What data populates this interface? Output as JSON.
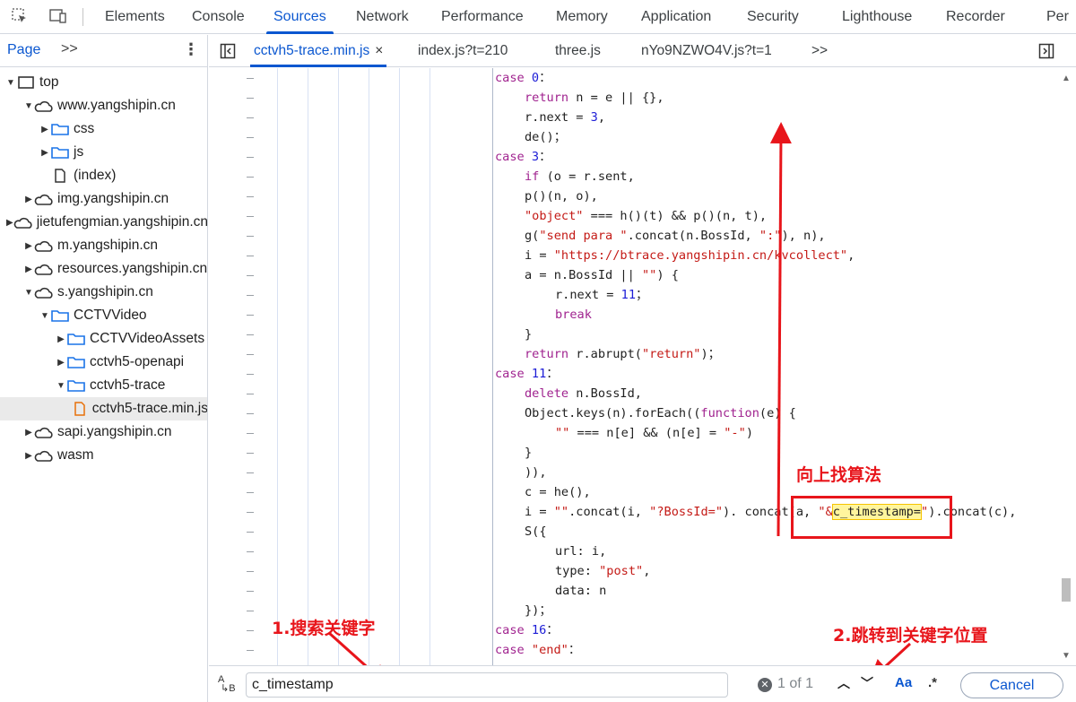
{
  "top_tabs": [
    "Elements",
    "Console",
    "Sources",
    "Network",
    "Performance",
    "Memory",
    "Application",
    "Security",
    "Lighthouse",
    "Recorder",
    "Per"
  ],
  "active_top_tab": "Sources",
  "navigator": {
    "tab": "Page",
    "more": ">>",
    "tree": [
      {
        "label": "top",
        "icon": "frame-icon",
        "arrow": "down"
      },
      {
        "label": "www.yangshipin.cn",
        "icon": "cloud-icon",
        "arrow": "down"
      },
      {
        "label": "css",
        "icon": "folder-icon",
        "arrow": "right"
      },
      {
        "label": "js",
        "icon": "folder-icon",
        "arrow": "right"
      },
      {
        "label": "(index)",
        "icon": "file-icon",
        "arrow": ""
      },
      {
        "label": "img.yangshipin.cn",
        "icon": "cloud-icon",
        "arrow": "right"
      },
      {
        "label": "jietufengmian.yangshipin.cn",
        "icon": "cloud-icon",
        "arrow": "right"
      },
      {
        "label": "m.yangshipin.cn",
        "icon": "cloud-icon",
        "arrow": "right"
      },
      {
        "label": "resources.yangshipin.cn",
        "icon": "cloud-icon",
        "arrow": "right"
      },
      {
        "label": "s.yangshipin.cn",
        "icon": "cloud-icon",
        "arrow": "down"
      },
      {
        "label": "CCTVVideo",
        "icon": "folder-icon",
        "arrow": "down"
      },
      {
        "label": "CCTVVideoAssets",
        "icon": "folder-icon",
        "arrow": "right"
      },
      {
        "label": "cctvh5-openapi",
        "icon": "folder-icon",
        "arrow": "right"
      },
      {
        "label": "cctvh5-trace",
        "icon": "folder-icon",
        "arrow": "down"
      },
      {
        "label": "cctvh5-trace.min.js",
        "icon": "js-file-icon",
        "arrow": "",
        "selected": true
      },
      {
        "label": "sapi.yangshipin.cn",
        "icon": "cloud-icon",
        "arrow": "right"
      },
      {
        "label": "wasm",
        "icon": "cloud-icon",
        "arrow": "right"
      }
    ]
  },
  "editor_tabs": [
    {
      "label": "cctvh5-trace.min.js",
      "active": true,
      "close": "×"
    },
    {
      "label": "index.js?t=210"
    },
    {
      "label": "three.js"
    },
    {
      "label": "nYo9NZWO4V.js?t=1"
    }
  ],
  "editor_tabs_more": ">>",
  "code_lines": [
    {
      "t": [
        [
          "kw",
          "case "
        ],
        [
          "num",
          "0"
        ],
        [
          "",
          "："
        ]
      ]
    },
    {
      "t": [
        [
          "kw",
          "return "
        ],
        [
          "",
          "n = e || {},"
        ]
      ]
    },
    {
      "t": [
        [
          "",
          "r.next = "
        ],
        [
          "num",
          "3"
        ],
        [
          "",
          ","
        ]
      ]
    },
    {
      "t": [
        [
          "",
          "de()；"
        ]
      ]
    },
    {
      "t": [
        [
          "kw",
          "case "
        ],
        [
          "num",
          "3"
        ],
        [
          "",
          "："
        ]
      ]
    },
    {
      "t": [
        [
          "kw",
          "if "
        ],
        [
          "",
          "(o = r.sent,"
        ]
      ]
    },
    {
      "t": [
        [
          "",
          "p()(n, o),"
        ]
      ]
    },
    {
      "t": [
        [
          "str",
          "\"object\""
        ],
        [
          "",
          " === h()(t) && p()(n, t),"
        ]
      ]
    },
    {
      "t": [
        [
          "",
          "g("
        ],
        [
          "str",
          "\"send para \""
        ],
        [
          "",
          ".concat(n.BossId, "
        ],
        [
          "str",
          "\":\""
        ],
        [
          "",
          "), n),"
        ]
      ]
    },
    {
      "t": [
        [
          "",
          "i = "
        ],
        [
          "str",
          "\"https://btrace.yangshipin.cn/kvcollect\""
        ],
        [
          "",
          ","
        ]
      ]
    },
    {
      "t": [
        [
          "",
          "a = n.BossId || "
        ],
        [
          "str",
          "\"\""
        ],
        [
          "",
          ") {"
        ]
      ]
    },
    {
      "t": [
        [
          "",
          "r.next = "
        ],
        [
          "num",
          "11"
        ],
        [
          "",
          "；"
        ]
      ]
    },
    {
      "t": [
        [
          "kw",
          "break"
        ]
      ]
    },
    {
      "t": [
        [
          "",
          "}"
        ]
      ]
    },
    {
      "t": [
        [
          "kw",
          "return "
        ],
        [
          "",
          "r.abrupt("
        ],
        [
          "str",
          "\"return\""
        ],
        [
          "",
          ")；"
        ]
      ]
    },
    {
      "t": [
        [
          "kw",
          "case "
        ],
        [
          "num",
          "11"
        ],
        [
          "",
          "："
        ]
      ]
    },
    {
      "t": [
        [
          "kw",
          "delete "
        ],
        [
          "",
          "n.BossId,"
        ]
      ]
    },
    {
      "t": [
        [
          "",
          "Object.keys(n).forEach(("
        ],
        [
          "kw",
          "function"
        ],
        [
          "",
          "(e) {"
        ]
      ]
    },
    {
      "t": [
        [
          "str",
          "\"\""
        ],
        [
          "",
          " === n[e] && (n[e] = "
        ],
        [
          "str",
          "\"-\""
        ],
        [
          "",
          ")"
        ]
      ]
    },
    {
      "t": [
        [
          "",
          "}"
        ]
      ]
    },
    {
      "t": [
        [
          "",
          ")),"
        ]
      ]
    },
    {
      "t": [
        [
          "",
          "c = he(),"
        ]
      ]
    },
    {
      "t": [
        [
          "",
          "i = "
        ],
        [
          "str",
          "\"\""
        ],
        [
          "",
          ".concat(i, "
        ],
        [
          "str",
          "\"?BossId=\""
        ],
        [
          "",
          "). concat(a, "
        ],
        [
          "str",
          "\"&"
        ],
        [
          "hl",
          "c_timestamp="
        ],
        [
          "str",
          "\""
        ],
        [
          "",
          ").concat(c),"
        ]
      ]
    },
    {
      "t": [
        [
          "",
          "S({"
        ]
      ]
    },
    {
      "t": [
        [
          "",
          "url: i,"
        ]
      ]
    },
    {
      "t": [
        [
          "",
          "type: "
        ],
        [
          "str",
          "\"post\""
        ],
        [
          "",
          ","
        ]
      ]
    },
    {
      "t": [
        [
          "",
          "data: n"
        ]
      ]
    },
    {
      "t": [
        [
          "",
          "})；"
        ]
      ]
    },
    {
      "t": [
        [
          "kw",
          "case "
        ],
        [
          "num",
          "16"
        ],
        [
          "",
          "："
        ]
      ]
    },
    {
      "t": [
        [
          "kw",
          "case "
        ],
        [
          "str",
          "\"end\""
        ],
        [
          "",
          "："
        ]
      ]
    }
  ],
  "annotations": {
    "find_algorithm": "向上找算法",
    "step1": "1.搜索关键字",
    "step2": "2.跳转到关键字位置"
  },
  "search": {
    "value": "c_timestamp",
    "count": "1 of 1",
    "case_label": "Aa",
    "regex_label": ".*",
    "cancel": "Cancel"
  },
  "colors": {
    "accent": "#0b57d0",
    "annotation": "#e8151b",
    "highlight": "#fff59d"
  }
}
